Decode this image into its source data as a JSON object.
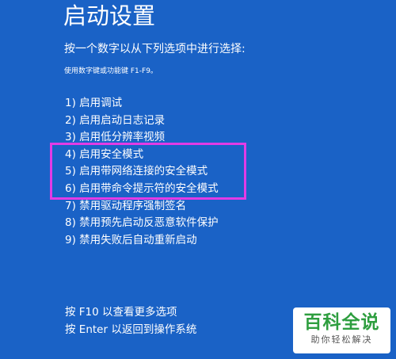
{
  "screen": {
    "title": "启动设置",
    "instruction": "按一个数字以从下列选项中进行选择:",
    "hint": "使用数字键或功能键 F1-F9。",
    "options": [
      {
        "label": "1) 启用调试"
      },
      {
        "label": "2) 启用启动日志记录"
      },
      {
        "label": "3) 启用低分辨率视频"
      },
      {
        "label": "4) 启用安全模式"
      },
      {
        "label": "5) 启用带网络连接的安全模式"
      },
      {
        "label": "6) 启用带命令提示符的安全模式"
      },
      {
        "label": "7) 禁用驱动程序强制签名"
      },
      {
        "label": "8) 禁用预先启动反恶意软件保护"
      },
      {
        "label": "9) 禁用失败后自动重新启动"
      }
    ],
    "footer": {
      "more_options": "按 F10 以查看更多选项",
      "return_os": "按 Enter 以返回到操作系统"
    }
  },
  "watermark": {
    "brand": "百科全说",
    "slogan": "助你轻松解决"
  },
  "colors": {
    "background": "#1A62C6",
    "text": "#FFFFFF",
    "highlight_border": "#E23BE6",
    "watermark_brand": "#2E9E3F"
  }
}
